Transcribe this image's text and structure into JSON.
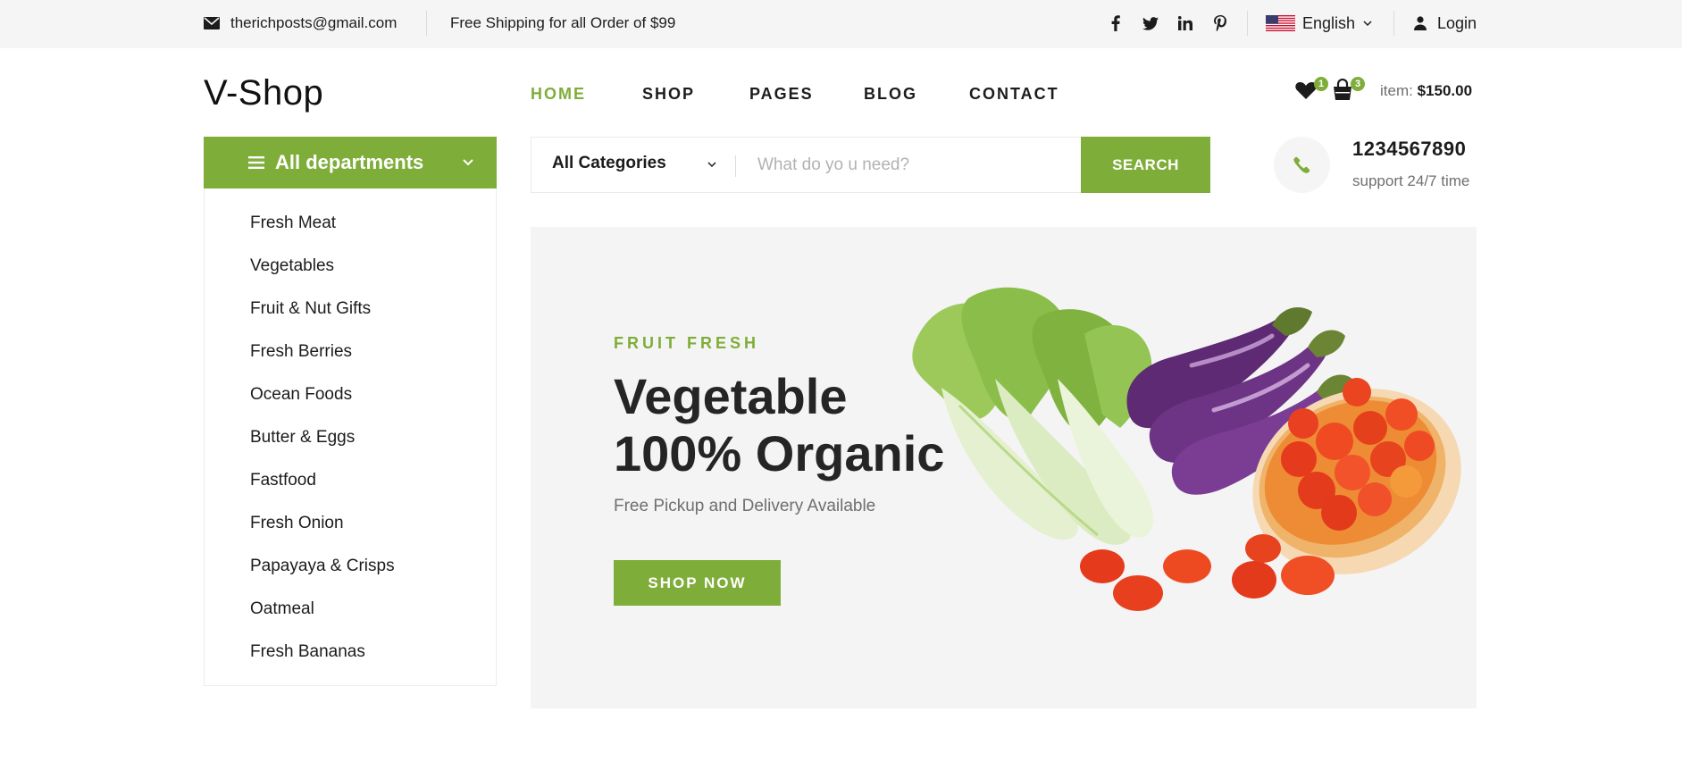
{
  "topbar": {
    "email": "therichposts@gmail.com",
    "shipping": "Free Shipping for all Order of $99",
    "social": [
      "facebook-icon",
      "twitter-icon",
      "linkedin-icon",
      "pinterest-icon"
    ],
    "language": "English",
    "login": "Login"
  },
  "header": {
    "logo": "V-Shop",
    "nav": [
      "HOME",
      "SHOP",
      "PAGES",
      "BLOG",
      "CONTACT"
    ],
    "active_nav": "HOME",
    "wishlist_count": "1",
    "cart_count": "3",
    "item_label": "item:",
    "item_total": "$150.00"
  },
  "departments": {
    "title": "All departments",
    "items": [
      "Fresh Meat",
      "Vegetables",
      "Fruit & Nut Gifts",
      "Fresh Berries",
      "Ocean Foods",
      "Butter & Eggs",
      "Fastfood",
      "Fresh Onion",
      "Papayaya & Crisps",
      "Oatmeal",
      "Fresh Bananas"
    ]
  },
  "search": {
    "category": "All Categories",
    "placeholder": "What do yo u need?",
    "button": "SEARCH"
  },
  "phone": {
    "number": "1234567890",
    "support": "support 24/7 time"
  },
  "hero": {
    "kicker": "FRUIT FRESH",
    "title_line1": "Vegetable",
    "title_line2": "100% Organic",
    "subtitle": "Free Pickup and Delivery Available",
    "button": "SHOP NOW"
  },
  "colors": {
    "accent": "#7fad39",
    "topbar_bg": "#f5f5f5",
    "hero_bg": "#f4f4f4",
    "text": "#1c1c1c"
  }
}
